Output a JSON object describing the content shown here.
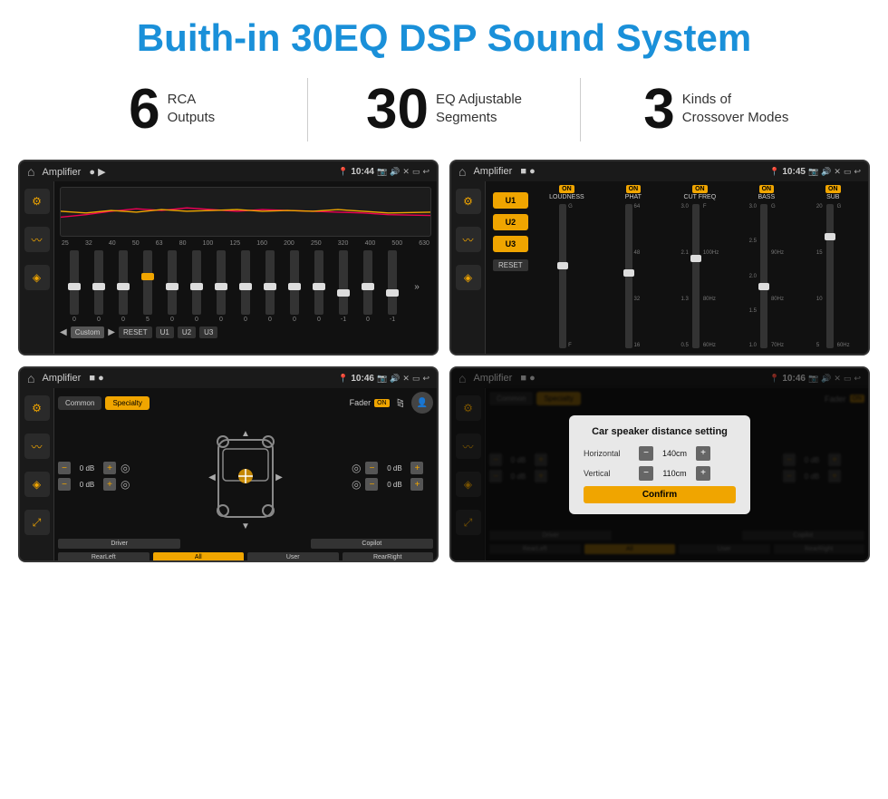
{
  "header": {
    "title": "Buith-in 30EQ DSP Sound System"
  },
  "stats": [
    {
      "number": "6",
      "label": "RCA\nOutputs"
    },
    {
      "number": "30",
      "label": "EQ Adjustable\nSegments"
    },
    {
      "number": "3",
      "label": "Kinds of\nCrossover Modes"
    }
  ],
  "screens": {
    "eq": {
      "status_bar": {
        "app": "Amplifier",
        "time": "10:44"
      },
      "freq_labels": [
        "25",
        "32",
        "40",
        "50",
        "63",
        "80",
        "100",
        "125",
        "160",
        "200",
        "250",
        "320",
        "400",
        "500",
        "630"
      ],
      "slider_values": [
        "0",
        "0",
        "0",
        "5",
        "0",
        "0",
        "0",
        "0",
        "0",
        "0",
        "0",
        "-1",
        "0",
        "-1"
      ],
      "preset_label": "Custom",
      "buttons": [
        "RESET",
        "U1",
        "U2",
        "U3"
      ]
    },
    "crossover": {
      "status_bar": {
        "app": "Amplifier",
        "time": "10:45"
      },
      "u_buttons": [
        "U1",
        "U2",
        "U3"
      ],
      "channels": [
        {
          "on": true,
          "label": "LOUDNESS"
        },
        {
          "on": true,
          "label": "PHAT"
        },
        {
          "on": true,
          "label": "CUT FREQ"
        },
        {
          "on": true,
          "label": "BASS"
        },
        {
          "on": true,
          "label": "SUB"
        }
      ],
      "reset_label": "RESET"
    },
    "fader": {
      "status_bar": {
        "app": "Amplifier",
        "time": "10:46"
      },
      "tabs": [
        "Common",
        "Specialty"
      ],
      "active_tab": 1,
      "fader_label": "Fader",
      "fader_on": true,
      "controls": {
        "left_top": "0 dB",
        "left_bottom": "0 dB",
        "right_top": "0 dB",
        "right_bottom": "0 dB"
      },
      "bottom_buttons": [
        "Driver",
        "",
        "Copilot",
        "RearLeft",
        "All",
        "User",
        "RearRight"
      ]
    },
    "distance": {
      "status_bar": {
        "app": "Amplifier",
        "time": "10:46"
      },
      "tabs": [
        "Common",
        "Specialty"
      ],
      "dialog": {
        "title": "Car speaker distance setting",
        "horizontal_label": "Horizontal",
        "horizontal_value": "140cm",
        "vertical_label": "Vertical",
        "vertical_value": "110cm",
        "confirm_label": "Confirm"
      },
      "bottom_buttons": [
        "Driver",
        "RearLeft",
        "All",
        "User",
        "RearRight"
      ]
    }
  }
}
